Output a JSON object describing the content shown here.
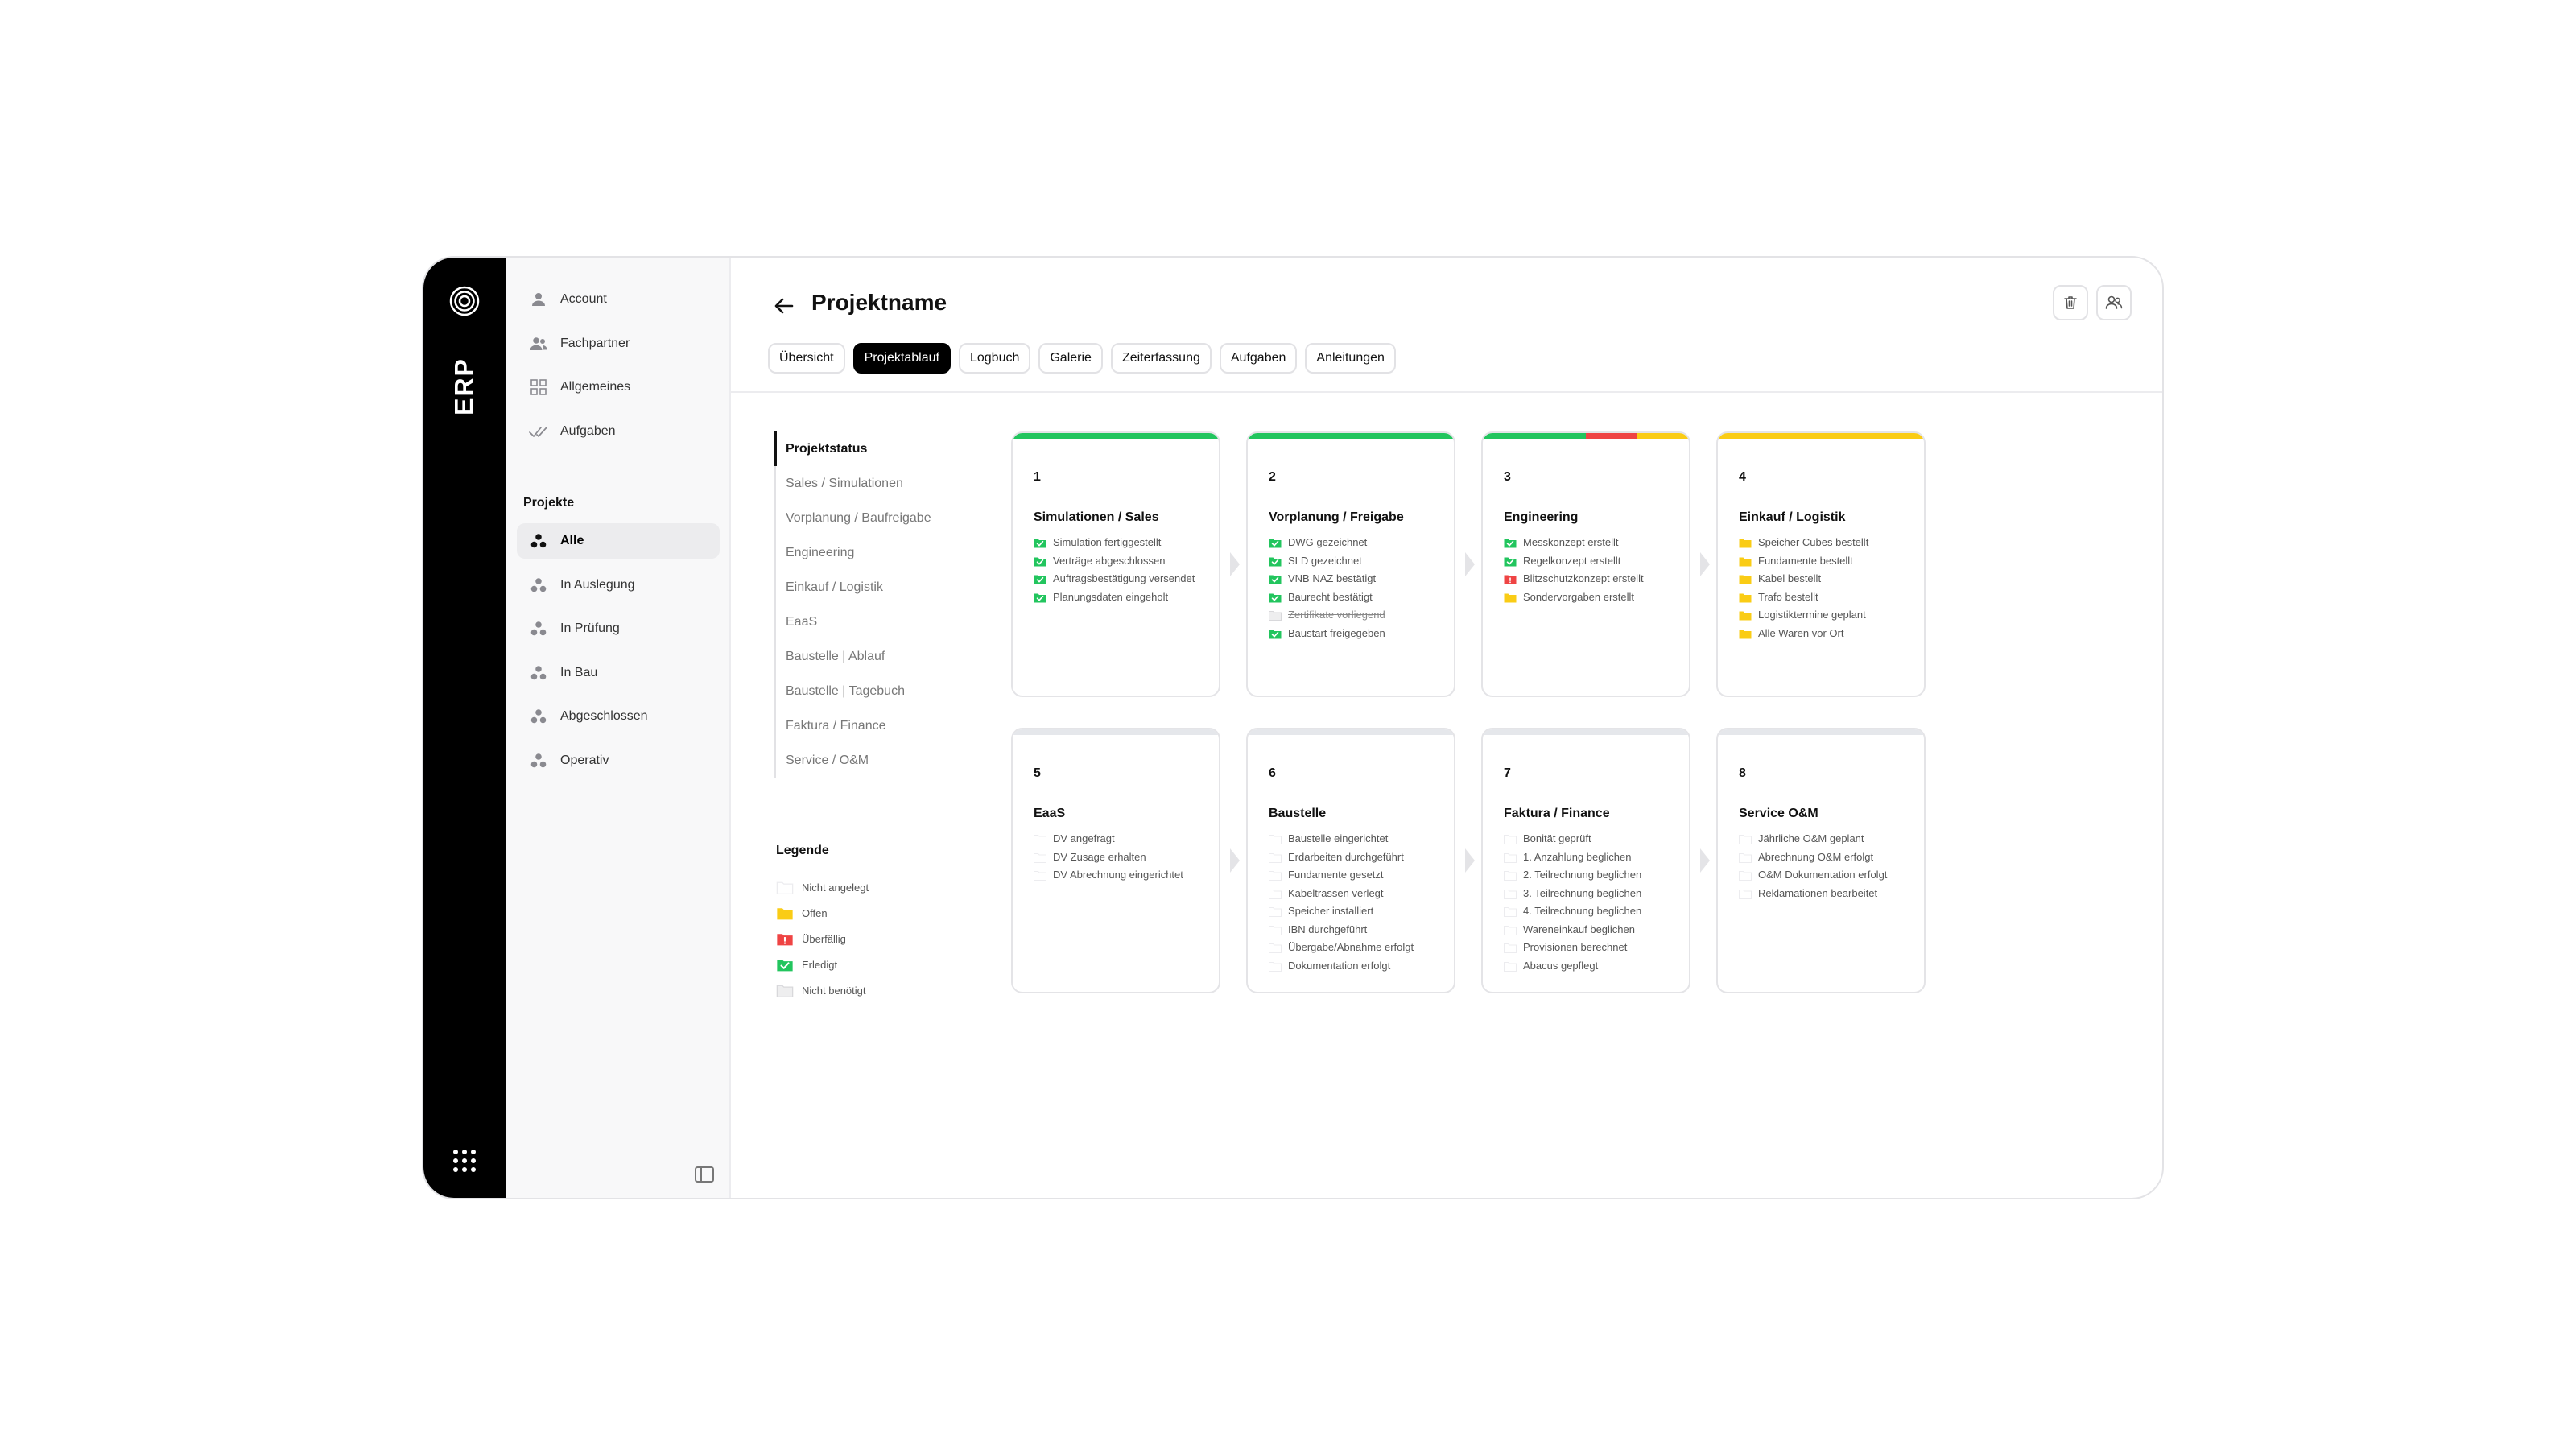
{
  "app": {
    "brand": "ERP"
  },
  "sidebar": {
    "items": [
      {
        "label": "Account",
        "icon": "user-icon"
      },
      {
        "label": "Fachpartner",
        "icon": "users-icon"
      },
      {
        "label": "Allgemeines",
        "icon": "grid-icon"
      },
      {
        "label": "Aufgaben",
        "icon": "double-check-icon"
      }
    ],
    "section_title": "Projekte",
    "projects": [
      {
        "label": "Alle",
        "active": true
      },
      {
        "label": "In Auslegung"
      },
      {
        "label": "In Prüfung"
      },
      {
        "label": "In Bau"
      },
      {
        "label": "Abgeschlossen"
      },
      {
        "label": "Operativ"
      }
    ]
  },
  "header": {
    "title": "Projektname"
  },
  "tabs": [
    "Übersicht",
    "Projektablauf",
    "Logbuch",
    "Galerie",
    "Zeiterfassung",
    "Aufgaben",
    "Anleitungen"
  ],
  "active_tab": "Projektablauf",
  "status_list": {
    "heading": "Projektstatus",
    "items": [
      "Sales / Simulationen",
      "Vorplanung / Baufreigabe",
      "Engineering",
      "Einkauf / Logistik",
      "EaaS",
      "Baustelle | Ablauf",
      "Baustelle | Tagebuch",
      "Faktura / Finance",
      "Service / O&M"
    ]
  },
  "legend": {
    "title": "Legende",
    "items": [
      {
        "label": "Nicht angelegt",
        "status": "none"
      },
      {
        "label": "Offen",
        "status": "open"
      },
      {
        "label": "Überfällig",
        "status": "overdue"
      },
      {
        "label": "Erledigt",
        "status": "done"
      },
      {
        "label": "Nicht benötigt",
        "status": "notneeded"
      }
    ]
  },
  "colors": {
    "done": "#22c55e",
    "open": "#facc15",
    "overdue": "#ef4444",
    "none": "#e5e7eb",
    "notneeded": "#e5e7eb"
  },
  "cards": [
    {
      "number": "1",
      "title": "Simulationen / Sales",
      "items": [
        {
          "label": "Simulation fertiggestellt",
          "status": "done"
        },
        {
          "label": "Verträge abgeschlossen",
          "status": "done"
        },
        {
          "label": "Auftragsbestätigung versendet",
          "status": "done"
        },
        {
          "label": "Planungsdaten eingeholt",
          "status": "done"
        }
      ]
    },
    {
      "number": "2",
      "title": "Vorplanung / Freigabe",
      "items": [
        {
          "label": "DWG gezeichnet",
          "status": "done"
        },
        {
          "label": "SLD gezeichnet",
          "status": "done"
        },
        {
          "label": "VNB NAZ bestätigt",
          "status": "done"
        },
        {
          "label": "Baurecht bestätigt",
          "status": "done"
        },
        {
          "label": "Zertifikate vorliegend",
          "status": "notneeded"
        },
        {
          "label": "Baustart freigegeben",
          "status": "done"
        }
      ]
    },
    {
      "number": "3",
      "title": "Engineering",
      "items": [
        {
          "label": "Messkonzept erstellt",
          "status": "done"
        },
        {
          "label": "Regelkonzept erstellt",
          "status": "done"
        },
        {
          "label": "Blitzschutzkonzept erstellt",
          "status": "overdue"
        },
        {
          "label": "Sondervorgaben erstellt",
          "status": "open"
        }
      ]
    },
    {
      "number": "4",
      "title": "Einkauf / Logistik",
      "items": [
        {
          "label": "Speicher Cubes bestellt",
          "status": "open"
        },
        {
          "label": "Fundamente bestellt",
          "status": "open"
        },
        {
          "label": "Kabel bestellt",
          "status": "open"
        },
        {
          "label": "Trafo bestellt",
          "status": "open"
        },
        {
          "label": "Logistiktermine geplant",
          "status": "open"
        },
        {
          "label": "Alle Waren vor Ort",
          "status": "open"
        }
      ]
    },
    {
      "number": "5",
      "title": "EaaS",
      "items": [
        {
          "label": "DV angefragt",
          "status": "none"
        },
        {
          "label": "DV Zusage erhalten",
          "status": "none"
        },
        {
          "label": "DV Abrechnung eingerichtet",
          "status": "none"
        }
      ]
    },
    {
      "number": "6",
      "title": "Baustelle",
      "items": [
        {
          "label": "Baustelle eingerichtet",
          "status": "none"
        },
        {
          "label": "Erdarbeiten durchgeführt",
          "status": "none"
        },
        {
          "label": "Fundamente gesetzt",
          "status": "none"
        },
        {
          "label": "Kabeltrassen verlegt",
          "status": "none"
        },
        {
          "label": "Speicher installiert",
          "status": "none"
        },
        {
          "label": "IBN durchgeführt",
          "status": "none"
        },
        {
          "label": "Übergabe/Abnahme erfolgt",
          "status": "none"
        },
        {
          "label": "Dokumentation erfolgt",
          "status": "none"
        }
      ]
    },
    {
      "number": "7",
      "title": "Faktura / Finance",
      "items": [
        {
          "label": "Bonität geprüft",
          "status": "none"
        },
        {
          "label": "1. Anzahlung beglichen",
          "status": "none"
        },
        {
          "label": "2. Teilrechnung beglichen",
          "status": "none"
        },
        {
          "label": "3. Teilrechnung beglichen",
          "status": "none"
        },
        {
          "label": "4. Teilrechnung beglichen",
          "status": "none"
        },
        {
          "label": "Wareneinkauf beglichen",
          "status": "none"
        },
        {
          "label": "Provisionen berechnet",
          "status": "none"
        },
        {
          "label": "Abacus gepflegt",
          "status": "none"
        }
      ]
    },
    {
      "number": "8",
      "title": "Service O&M",
      "items": [
        {
          "label": "Jährliche O&M geplant",
          "status": "none"
        },
        {
          "label": "Abrechnung O&M erfolgt",
          "status": "none"
        },
        {
          "label": "O&M Dokumentation erfolgt",
          "status": "none"
        },
        {
          "label": "Reklamationen bearbeitet",
          "status": "none"
        }
      ]
    }
  ]
}
